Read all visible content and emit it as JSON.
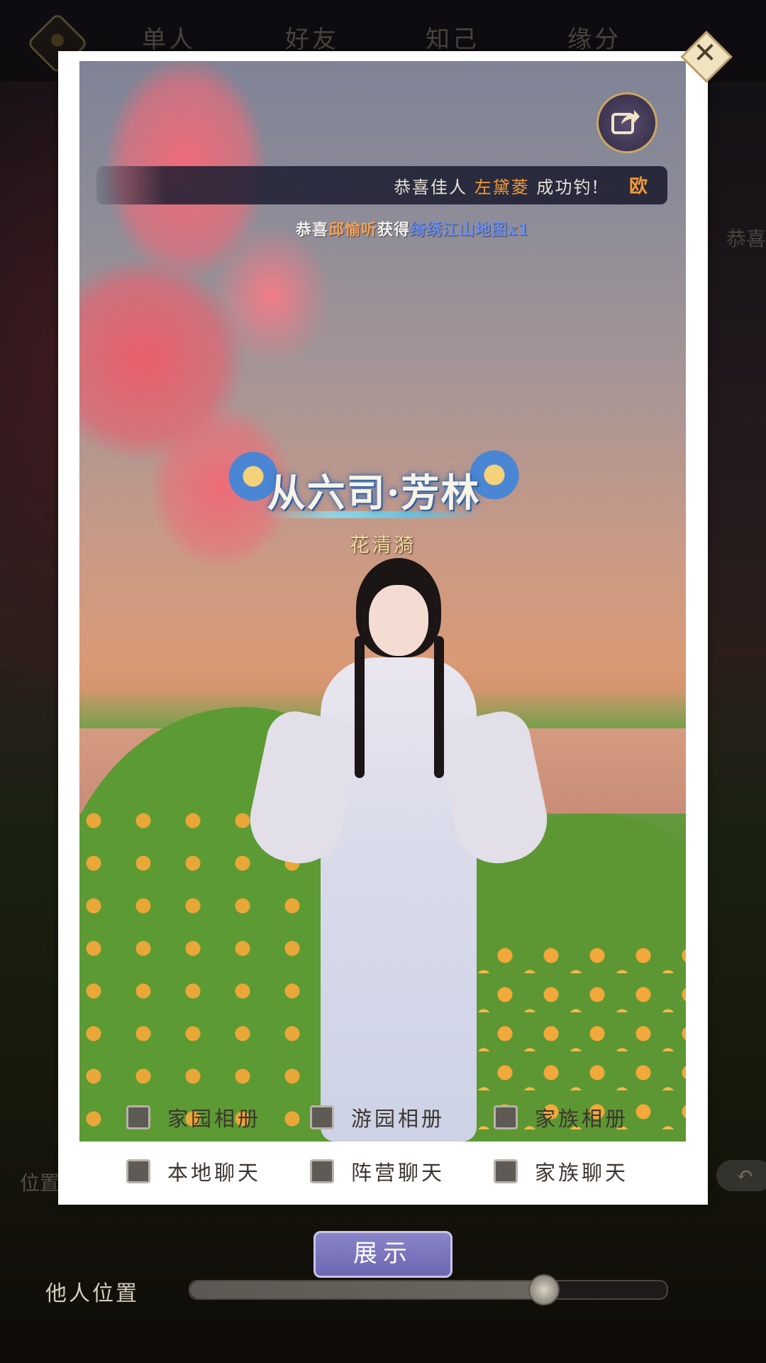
{
  "background": {
    "tabs": [
      "单人",
      "好友",
      "知己",
      "缘分"
    ],
    "right_text": "恭喜",
    "position_label": "位置",
    "back_button": "↶"
  },
  "dialog": {
    "marquee": {
      "prefix": "恭喜佳人",
      "name": "左黛菱",
      "suffix": "成功钓!",
      "tail": "欧"
    },
    "notice": {
      "prefix": "恭喜",
      "name": "邱愉听",
      "verb": "获得",
      "item": "绮绣江山地图x1"
    },
    "title_badge": "从六司·芳林",
    "character_name": "花清漪",
    "options": [
      {
        "label": "家园相册",
        "checked": false
      },
      {
        "label": "游园相册",
        "checked": false
      },
      {
        "label": "家族相册",
        "checked": false
      },
      {
        "label": "本地聊天",
        "checked": false
      },
      {
        "label": "阵营聊天",
        "checked": false
      },
      {
        "label": "家族聊天",
        "checked": false
      }
    ]
  },
  "controls": {
    "show_button": "展示",
    "others_position_label": "他人位置",
    "others_position_value": 0.74
  },
  "colors": {
    "highlight_orange": "#f09a36",
    "item_blue": "#6c8ee8",
    "show_button": "#7a74c0"
  }
}
